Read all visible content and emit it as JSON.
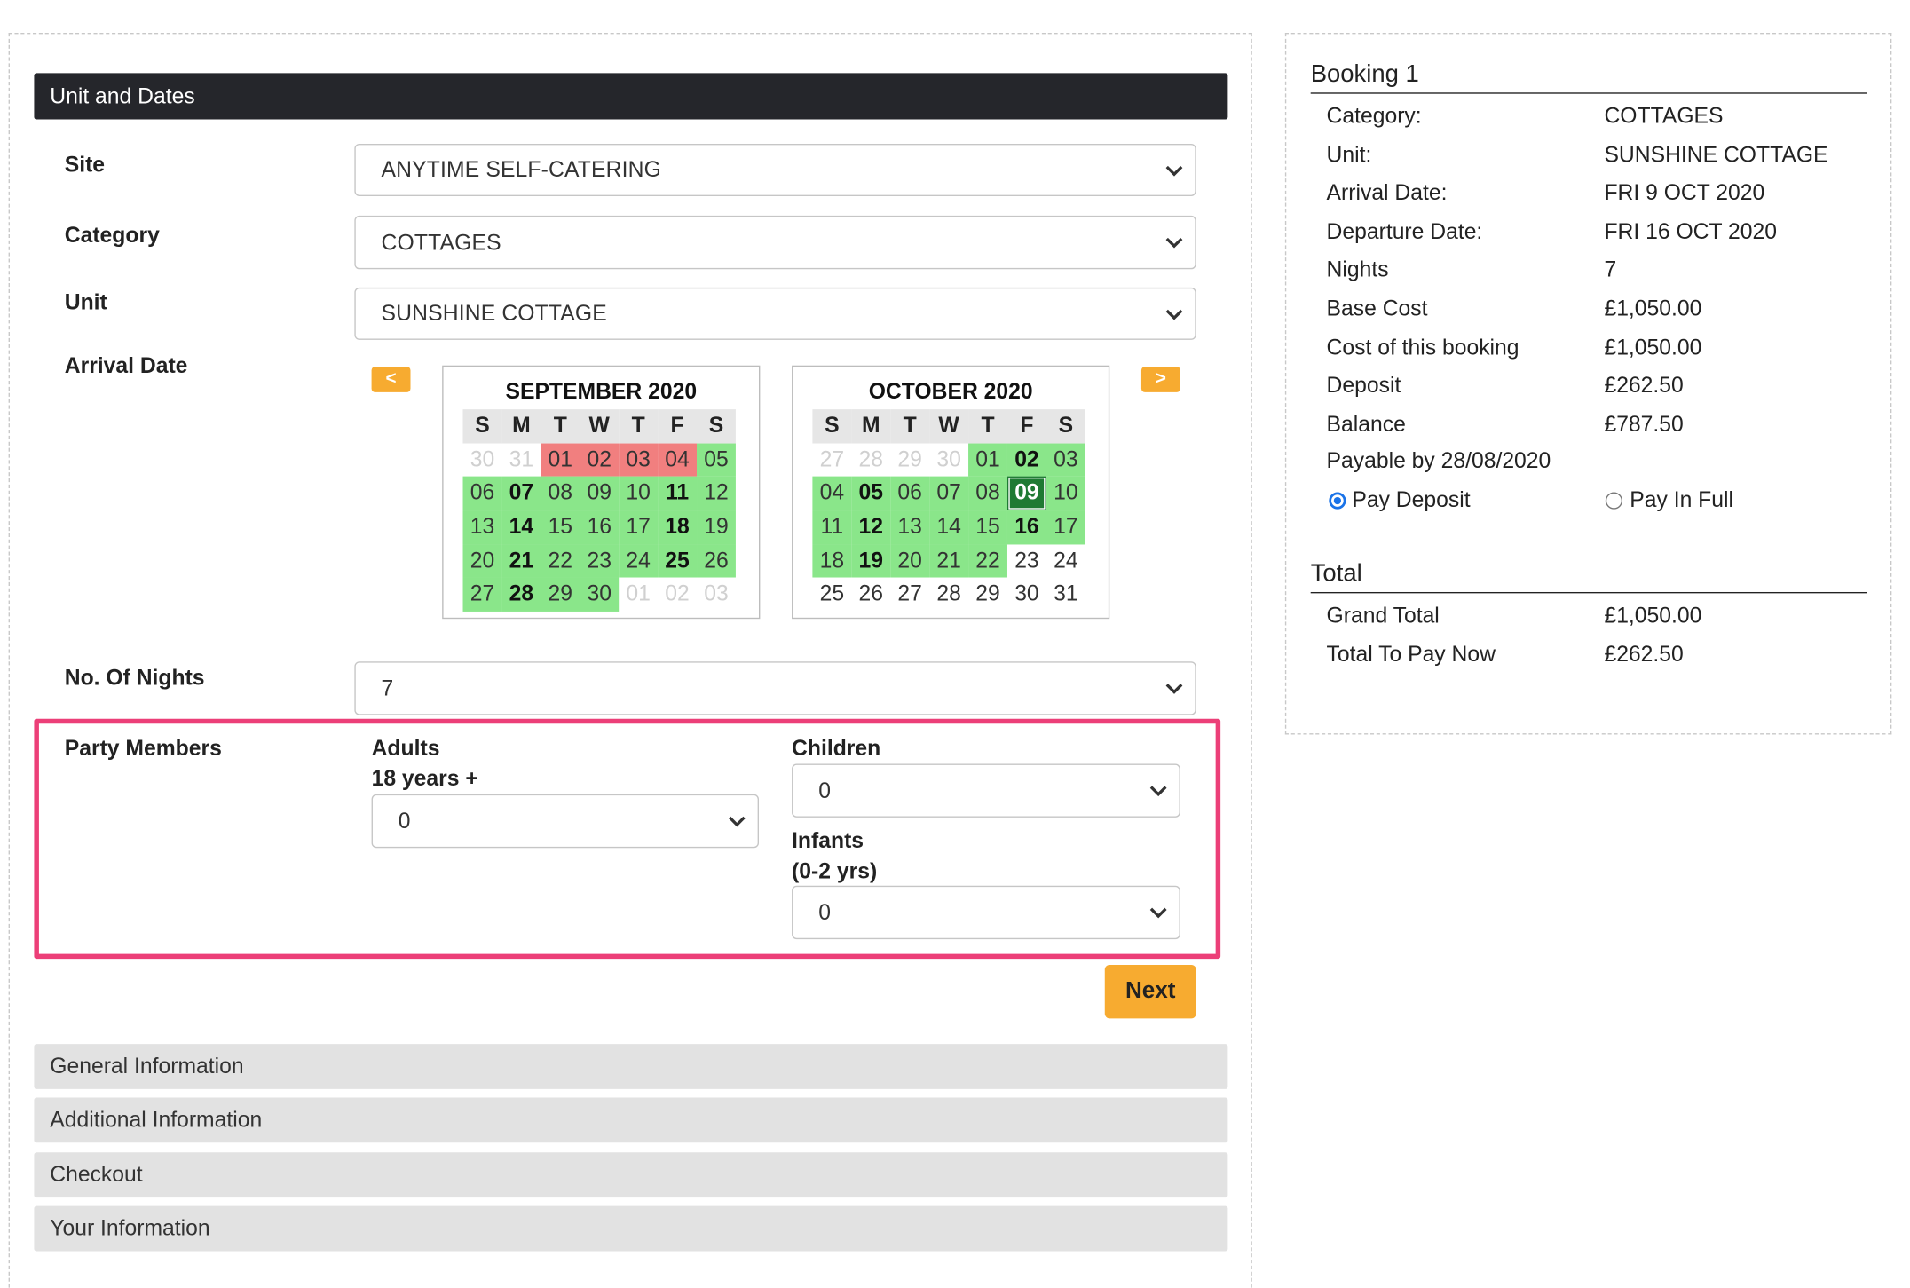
{
  "colors": {
    "accent": "#f7ab30",
    "header_bg": "#25262b",
    "available": "#8ae68a",
    "booked": "#f17f7f",
    "selected": "#1f7a33",
    "highlight_border": "#ec3f78"
  },
  "sections": {
    "unit_dates": "Unit and Dates",
    "general": "General Information",
    "additional": "Additional Information",
    "checkout": "Checkout",
    "your_info": "Your Information"
  },
  "form": {
    "site": {
      "label": "Site",
      "value": "ANYTIME SELF-CATERING"
    },
    "category": {
      "label": "Category",
      "value": "COTTAGES"
    },
    "unit": {
      "label": "Unit",
      "value": "SUNSHINE COTTAGE"
    },
    "arrival": {
      "label": "Arrival Date",
      "prev": "<",
      "next": ">"
    },
    "nights": {
      "label": "No. Of Nights",
      "value": "7"
    },
    "party": {
      "label": "Party Members",
      "adults_label": "Adults",
      "adults_sub": "18 years +",
      "adults_value": "0",
      "children_label": "Children",
      "children_value": "0",
      "infants_label": "Infants",
      "infants_sub": "(0-2 yrs)",
      "infants_value": "0"
    },
    "next_label": "Next"
  },
  "calendars": [
    {
      "title": "SEPTEMBER 2020",
      "dow": [
        "S",
        "M",
        "T",
        "W",
        "T",
        "F",
        "S"
      ],
      "days": [
        {
          "d": "30",
          "s": "other"
        },
        {
          "d": "31",
          "s": "other"
        },
        {
          "d": "01",
          "s": "booked"
        },
        {
          "d": "02",
          "s": "booked"
        },
        {
          "d": "03",
          "s": "booked"
        },
        {
          "d": "04",
          "s": "booked"
        },
        {
          "d": "05",
          "s": "avail"
        },
        {
          "d": "06",
          "s": "avail"
        },
        {
          "d": "07",
          "s": "avail bold"
        },
        {
          "d": "08",
          "s": "avail"
        },
        {
          "d": "09",
          "s": "avail"
        },
        {
          "d": "10",
          "s": "avail"
        },
        {
          "d": "11",
          "s": "avail bold"
        },
        {
          "d": "12",
          "s": "avail"
        },
        {
          "d": "13",
          "s": "avail"
        },
        {
          "d": "14",
          "s": "avail bold"
        },
        {
          "d": "15",
          "s": "avail"
        },
        {
          "d": "16",
          "s": "avail"
        },
        {
          "d": "17",
          "s": "avail"
        },
        {
          "d": "18",
          "s": "avail bold"
        },
        {
          "d": "19",
          "s": "avail"
        },
        {
          "d": "20",
          "s": "avail"
        },
        {
          "d": "21",
          "s": "avail bold"
        },
        {
          "d": "22",
          "s": "avail"
        },
        {
          "d": "23",
          "s": "avail"
        },
        {
          "d": "24",
          "s": "avail"
        },
        {
          "d": "25",
          "s": "avail bold"
        },
        {
          "d": "26",
          "s": "avail"
        },
        {
          "d": "27",
          "s": "avail"
        },
        {
          "d": "28",
          "s": "avail bold"
        },
        {
          "d": "29",
          "s": "avail"
        },
        {
          "d": "30",
          "s": "avail"
        },
        {
          "d": "01",
          "s": "other"
        },
        {
          "d": "02",
          "s": "other"
        },
        {
          "d": "03",
          "s": "other"
        }
      ]
    },
    {
      "title": "OCTOBER 2020",
      "dow": [
        "S",
        "M",
        "T",
        "W",
        "T",
        "F",
        "S"
      ],
      "days": [
        {
          "d": "27",
          "s": "other"
        },
        {
          "d": "28",
          "s": "other"
        },
        {
          "d": "29",
          "s": "other"
        },
        {
          "d": "30",
          "s": "other"
        },
        {
          "d": "01",
          "s": "avail"
        },
        {
          "d": "02",
          "s": "avail bold"
        },
        {
          "d": "03",
          "s": "avail"
        },
        {
          "d": "04",
          "s": "avail"
        },
        {
          "d": "05",
          "s": "avail bold"
        },
        {
          "d": "06",
          "s": "avail"
        },
        {
          "d": "07",
          "s": "avail"
        },
        {
          "d": "08",
          "s": "avail"
        },
        {
          "d": "09",
          "s": "selected"
        },
        {
          "d": "10",
          "s": "avail"
        },
        {
          "d": "11",
          "s": "avail"
        },
        {
          "d": "12",
          "s": "avail bold"
        },
        {
          "d": "13",
          "s": "avail"
        },
        {
          "d": "14",
          "s": "avail"
        },
        {
          "d": "15",
          "s": "avail"
        },
        {
          "d": "16",
          "s": "avail bold"
        },
        {
          "d": "17",
          "s": "avail"
        },
        {
          "d": "18",
          "s": "avail"
        },
        {
          "d": "19",
          "s": "avail bold"
        },
        {
          "d": "20",
          "s": "avail"
        },
        {
          "d": "21",
          "s": "avail"
        },
        {
          "d": "22",
          "s": "avail"
        },
        {
          "d": "23",
          "s": "plain"
        },
        {
          "d": "24",
          "s": "plain"
        },
        {
          "d": "25",
          "s": "plain"
        },
        {
          "d": "26",
          "s": "plain"
        },
        {
          "d": "27",
          "s": "plain"
        },
        {
          "d": "28",
          "s": "plain"
        },
        {
          "d": "29",
          "s": "plain"
        },
        {
          "d": "30",
          "s": "plain"
        },
        {
          "d": "31",
          "s": "plain"
        }
      ]
    }
  ],
  "summary": {
    "title": "Booking 1",
    "rows": [
      {
        "k": "Category:",
        "v": "COTTAGES"
      },
      {
        "k": "Unit:",
        "v": "SUNSHINE COTTAGE"
      },
      {
        "k": "Arrival Date:",
        "v": "FRI 9 OCT 2020"
      },
      {
        "k": "Departure Date:",
        "v": "FRI 16 OCT 2020"
      },
      {
        "k": "Nights",
        "v": "7"
      },
      {
        "k": "Base Cost",
        "v": "£1,050.00"
      },
      {
        "k": "Cost of this booking",
        "v": "£1,050.00"
      },
      {
        "k": "Deposit",
        "v": "£262.50"
      },
      {
        "k": "Balance",
        "v": "£787.50"
      }
    ],
    "payable": "Payable by 28/08/2020",
    "pay_deposit": "Pay Deposit",
    "pay_full": "Pay In Full",
    "total_title": "Total",
    "grand_total_label": "Grand Total",
    "grand_total_value": "£1,050.00",
    "to_pay_label": "Total To Pay Now",
    "to_pay_value": "£262.50"
  }
}
